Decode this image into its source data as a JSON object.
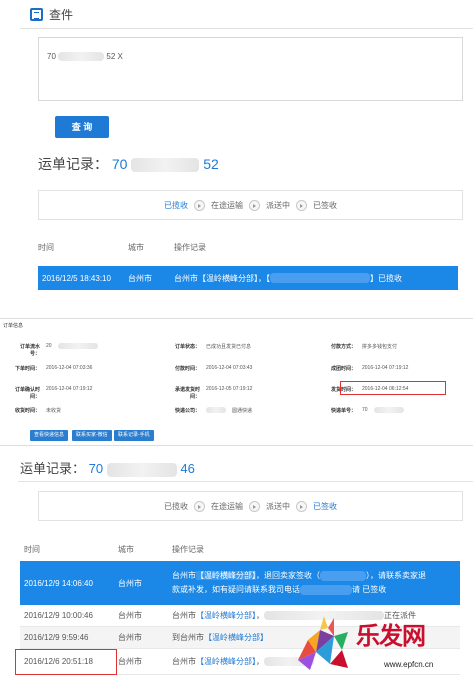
{
  "panel1": {
    "title": "查件",
    "input_value_prefix": "70",
    "input_value_suffix": "52 X",
    "query_button": "查 询",
    "record_label": "运单记录：",
    "record_prefix": "70",
    "record_suffix": "52",
    "steps": [
      "已揽收",
      "在途运输",
      "派送中",
      "已签收"
    ],
    "active_step": 0,
    "columns": [
      "时间",
      "城市",
      "操作记录"
    ],
    "rows": [
      {
        "time": "2016/12/5 18:43:10",
        "city": "台州市",
        "op_prefix": "台州市【温岭横峰分部】，【",
        "op_suffix": "】已揽收"
      }
    ]
  },
  "panel2": {
    "title": "订单信息",
    "fields": [
      {
        "k": "订单流水号：",
        "v": "20"
      },
      {
        "k": "订单状态：",
        "v": "已成功且发货已付息"
      },
      {
        "k": "付款方式：",
        "v": "拼多多钱包支付"
      },
      {
        "k": "下单时间：",
        "v": "2016-12-04 07:03:36"
      },
      {
        "k": "付款时间：",
        "v": "2016-12-04 07:03:43"
      },
      {
        "k": "成团时间：",
        "v": "2016-12-04 07:19:12"
      },
      {
        "k": "订单确认时间：",
        "v": "2016-12-04 07:19:12"
      },
      {
        "k": "承诺发货时间：",
        "v": "2016-12-05 07:19:12"
      },
      {
        "k": "发货时间：",
        "v": "2016-12-04 06:12:54"
      },
      {
        "k": "收货时间：",
        "v": "未收货"
      },
      {
        "k": "快递公司：",
        "v": "圆通快递"
      },
      {
        "k": "快递单号：",
        "v": "70"
      }
    ],
    "buttons": [
      "查看快递信息",
      "联系买家-微信",
      "联系记录-手机"
    ]
  },
  "panel3": {
    "record_label": "运单记录：",
    "record_prefix": "70",
    "record_suffix": "46",
    "steps": [
      "已揽收",
      "在途运输",
      "派送中",
      "已签收"
    ],
    "active_step": 3,
    "columns": [
      "时间",
      "城市",
      "操作记录"
    ],
    "rows": [
      {
        "time": "2016/12/9 14:06:40",
        "city": "台州市",
        "op1": "台州市",
        "op_link": "【温岭横峰分部】",
        "op2": "，退回卖家签收（",
        "op3": "），请联系卖家退",
        "op4": "款或补发，如有疑问请联系我司电话",
        "op5": "请 已签收"
      },
      {
        "time": "2016/12/9 10:00:46",
        "city": "台州市",
        "op1": "台州市",
        "op_link": "【温岭横峰分部】",
        "op2": "，",
        "op3": "正在派件"
      },
      {
        "time": "2016/12/9 9:59:46",
        "city": "台州市",
        "op1": "到台州市",
        "op_link": "【温岭横峰分部】",
        "op2": ""
      },
      {
        "time": "2016/12/6 20:51:18",
        "city": "台州市",
        "op1": "台州市",
        "op_link": "【温岭横峰分部】",
        "op2": "，"
      }
    ]
  },
  "watermark": {
    "text": "乐发网",
    "url": "www.epfcn.cn"
  },
  "colors": {
    "accent": "#1f7ad6",
    "selected_row": "#1b87e6",
    "highlight_box": "#e23030",
    "watermark": "#c8102e"
  }
}
